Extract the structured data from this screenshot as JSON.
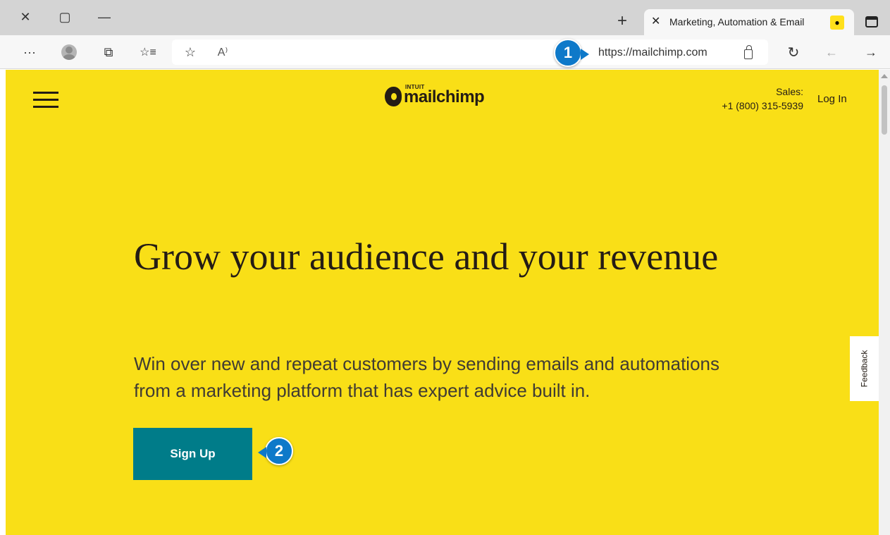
{
  "window": {
    "close_label": "✕",
    "restore_label": "▢",
    "minimize_label": "—"
  },
  "tab": {
    "close_label": "✕",
    "title": "Marketing, Automation & Email",
    "new_tab_label": "+"
  },
  "toolbar": {
    "more_label": "···",
    "collections_label": "⧉",
    "favorites_label": "☆≡",
    "add_favorite_label": "☆",
    "read_aloud_label": "A⁾",
    "refresh_label": "↻",
    "back_label": "←",
    "forward_label": "→"
  },
  "address": {
    "url": "https://mailchimp.com"
  },
  "callouts": [
    "1",
    "2"
  ],
  "site": {
    "logo_intuit": "INTUIT",
    "logo_name": "mailchimp",
    "sales_label": "Sales:",
    "sales_phone": "+1 (800) 315-5939",
    "login_label": "Log In",
    "headline": "Grow your audience and your revenue",
    "subtext": "Win over new and repeat customers by sending emails and automations from a marketing platform that has expert advice built in.",
    "signup_label": "Sign Up",
    "feedback_label": "Feedback"
  },
  "colors": {
    "brand_yellow": "#f9df17",
    "signup_teal": "#007c89",
    "callout_blue": "#0e79c9"
  }
}
